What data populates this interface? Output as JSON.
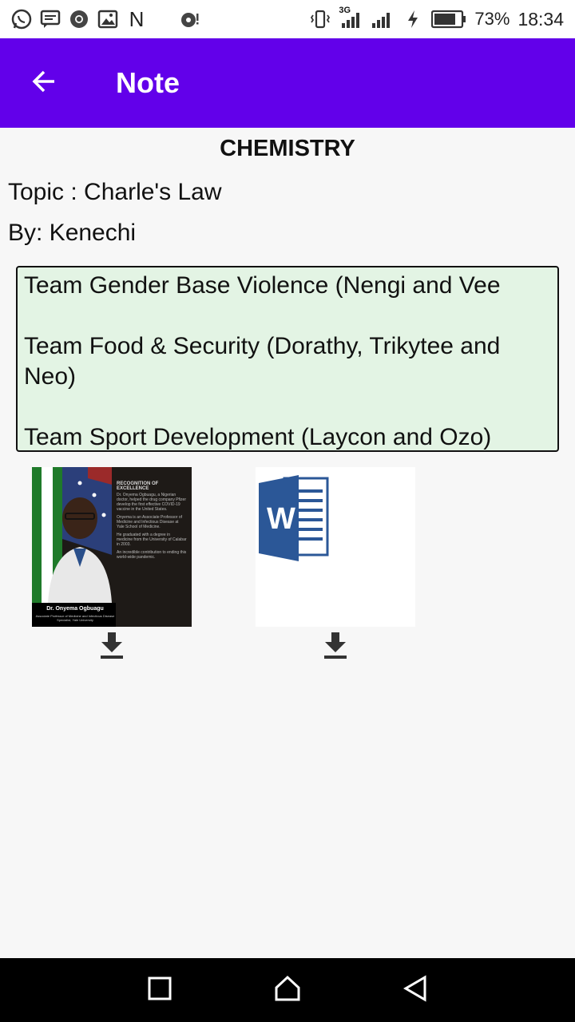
{
  "status_bar": {
    "battery": "73%",
    "time": "18:34",
    "network": "3G",
    "notification_letter": "N",
    "left_icons": [
      "whatsapp-icon",
      "message-icon",
      "chrome-icon",
      "image-icon",
      "n-icon",
      "media-icon"
    ],
    "right_icons": [
      "vibrate-icon",
      "signal-icon",
      "signal-icon",
      "charging-icon",
      "battery-icon"
    ]
  },
  "app_bar": {
    "title": "Note",
    "back_icon": "arrow-left-icon",
    "color": "#6200ea"
  },
  "note": {
    "subject": "CHEMISTRY",
    "topic": "Topic : Charle's Law",
    "author": "By: Kenechi",
    "body_lines": [
      "Team Gender Base Violence (Nengi and Vee",
      "",
      "Team Food & Security (Dorathy, Trikytee and Neo)",
      "",
      "Team Sport Development (Laycon and Ozo)"
    ],
    "box_color": "#e3f4e4"
  },
  "attachments": [
    {
      "type": "image",
      "heading": "RECOGNITION OF EXCELLENCE",
      "paragraphs": [
        "Dr. Onyema Ogbuagu, a Nigerian doctor, helped the drug company Pfizer develop the first effective COVID-19 vaccine in the United States.",
        "Onyema is an Associate Professor of Medicine and Infectious Disease at Yale School of Medicine.",
        "He graduated with a degree in medicine from the University of Calabar in 2003.",
        "An incredible contribution to ending this world-wide pandemic."
      ],
      "caption_name": "Dr. Onyema Ogbuagu",
      "caption_sub": "Associate Professor of Medicine and Infectious Disease Specialist, Yale University",
      "download_icon": "download-icon"
    },
    {
      "type": "word-document",
      "icon": "word-icon",
      "icon_letter": "W",
      "download_icon": "download-icon"
    }
  ],
  "nav_bar": {
    "recent_icon": "square-icon",
    "home_icon": "home-icon",
    "back_icon": "triangle-back-icon"
  }
}
